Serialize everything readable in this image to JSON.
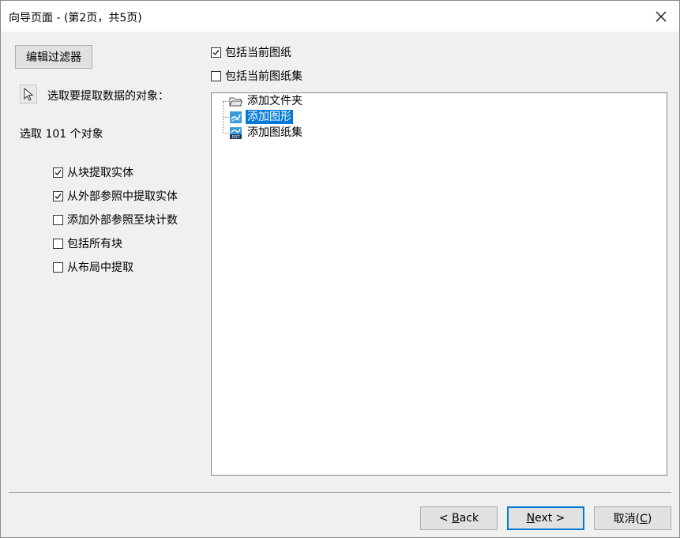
{
  "window": {
    "title": "向导页面 - (第2页，共5页)"
  },
  "left": {
    "edit_filter_label": "编辑过滤器",
    "select_prompt": "选取要提取数据的对象：",
    "selected_count": "选取 101 个对象",
    "options": [
      {
        "label": "从块提取实体",
        "checked": true
      },
      {
        "label": "从外部参照中提取实体",
        "checked": true
      },
      {
        "label": "添加外部参照至块计数",
        "checked": false
      },
      {
        "label": "包括所有块",
        "checked": false
      },
      {
        "label": "从布局中提取",
        "checked": false
      }
    ]
  },
  "right": {
    "include_current_drawing": {
      "label": "包括当前图纸",
      "checked": true
    },
    "include_current_sheetset": {
      "label": "包括当前图纸集",
      "checked": false
    },
    "tree": [
      {
        "label": "添加文件夹",
        "icon": "folder-icon",
        "selected": false
      },
      {
        "label": "添加图形",
        "icon": "dwg-file-icon",
        "selected": true
      },
      {
        "label": "添加图纸集",
        "icon": "dst-file-icon",
        "selected": false
      }
    ]
  },
  "footer": {
    "back_label": "< Back",
    "back_mnemonic": "B",
    "next_label": "Next >",
    "next_mnemonic": "N",
    "cancel_label": "取消(C)",
    "cancel_mnemonic": "C"
  },
  "colors": {
    "selection": "#0078d7",
    "default_button_border": "#0078d7"
  }
}
